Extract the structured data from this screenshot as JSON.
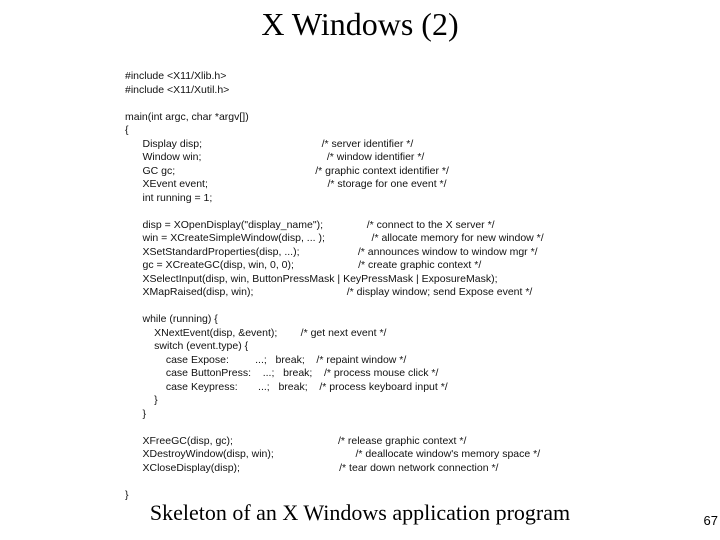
{
  "title": "X Windows (2)",
  "caption": "Skeleton of an X Windows application program",
  "page_number": "67",
  "code": "#include <X11/Xlib.h>\n#include <X11/Xutil.h>\n\nmain(int argc, char *argv[])\n{\n      Display disp;                                         /* server identifier */\n      Window win;                                           /* window identifier */\n      GC gc;                                                /* graphic context identifier */\n      XEvent event;                                         /* storage for one event */\n      int running = 1;\n\n      disp = XOpenDisplay(\"display_name\");               /* connect to the X server */\n      win = XCreateSimpleWindow(disp, ... );                /* allocate memory for new window */\n      XSetStandardProperties(disp, ...);                    /* announces window to window mgr */\n      gc = XCreateGC(disp, win, 0, 0);                      /* create graphic context */\n      XSelectInput(disp, win, ButtonPressMask | KeyPressMask | ExposureMask);\n      XMapRaised(disp, win);                                /* display window; send Expose event */\n\n      while (running) {\n          XNextEvent(disp, &event);        /* get next event */\n          switch (event.type) {\n              case Expose:         ...;   break;    /* repaint window */\n              case ButtonPress:    ...;   break;    /* process mouse click */\n              case Keypress:       ...;   break;    /* process keyboard input */\n          }\n      }\n\n      XFreeGC(disp, gc);                                    /* release graphic context */\n      XDestroyWindow(disp, win);                            /* deallocate window's memory space */\n      XCloseDisplay(disp);                                  /* tear down network connection */\n\n}"
}
